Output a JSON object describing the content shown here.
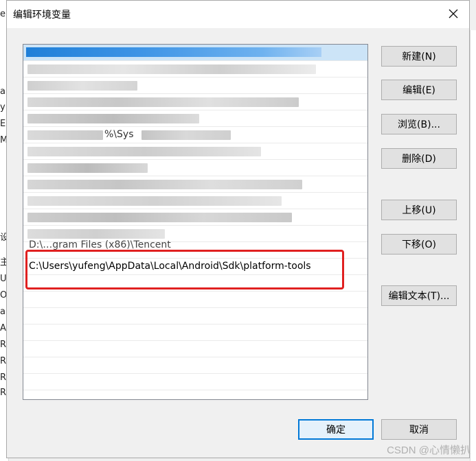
{
  "background_window": {
    "fragments": [
      "er",
      "a",
      "y",
      "E",
      "M",
      "设",
      "主",
      "U",
      "OS",
      "a",
      "A",
      "R",
      "R",
      "R",
      "R"
    ]
  },
  "dialog": {
    "title": "编辑环境变量",
    "close_glyph": "✕",
    "list": {
      "visible_partial_entry": "D:\\…gram Files (x86)\\Tencent",
      "new_entry": "C:\\Users\\yufeng\\AppData\\Local\\Android\\Sdk\\platform-tools",
      "partial_text": "%\\Sys"
    },
    "buttons": {
      "new": "新建(N)",
      "edit": "编辑(E)",
      "browse": "浏览(B)...",
      "delete": "删除(D)",
      "move_up": "上移(U)",
      "move_down": "下移(O)",
      "edit_text": "编辑文本(T)...",
      "ok": "确定",
      "cancel": "取消"
    }
  },
  "watermark": "CSDN @心情懒扒",
  "colors": {
    "accent": "#0078d7",
    "selection": "#cce4f7",
    "highlight": "#e02020"
  }
}
